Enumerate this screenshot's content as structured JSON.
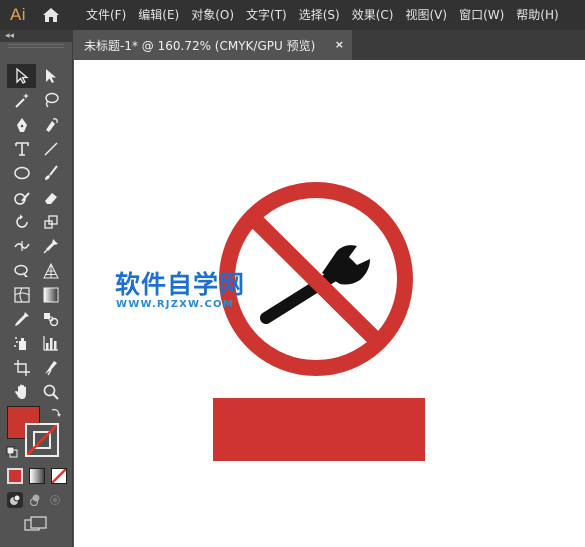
{
  "app": {
    "logo": "Ai",
    "home_icon": "home-icon"
  },
  "menu": {
    "items": [
      "文件(F)",
      "编辑(E)",
      "对象(O)",
      "文字(T)",
      "选择(S)",
      "效果(C)",
      "视图(V)",
      "窗口(W)",
      "帮助(H)"
    ]
  },
  "toolpanel": {
    "collapse_label": "◂◂",
    "tools": [
      "selection-tool-icon",
      "direct-selection-tool-icon",
      "magic-wand-tool-icon",
      "lasso-tool-icon",
      "pen-tool-icon",
      "curvature-tool-icon",
      "type-tool-icon",
      "line-segment-tool-icon",
      "ellipse-tool-icon",
      "paintbrush-tool-icon",
      "shaper-tool-icon",
      "eraser-tool-icon",
      "rotate-tool-icon",
      "scale-tool-icon",
      "width-tool-icon",
      "puppet-warp-tool-icon",
      "shape-builder-tool-icon",
      "perspective-grid-tool-icon",
      "mesh-tool-icon",
      "gradient-tool-icon",
      "eyedropper-tool-icon",
      "blend-tool-icon",
      "symbol-sprayer-tool-icon",
      "column-graph-tool-icon",
      "artboard-tool-icon",
      "slice-tool-icon",
      "hand-tool-icon",
      "zoom-tool-icon"
    ],
    "fill_color": "#c8362f",
    "stroke": "none"
  },
  "document": {
    "tab_label": "未标题-1* @ 160.72% (CMYK/GPU 预览)",
    "close_label": "×"
  },
  "artwork": {
    "sign_color": "#cf3530",
    "icon_color": "#111111",
    "subject": "wrench-icon"
  },
  "watermark": {
    "title": "软件自学网",
    "url": "WWW.RJZXW.COM"
  }
}
